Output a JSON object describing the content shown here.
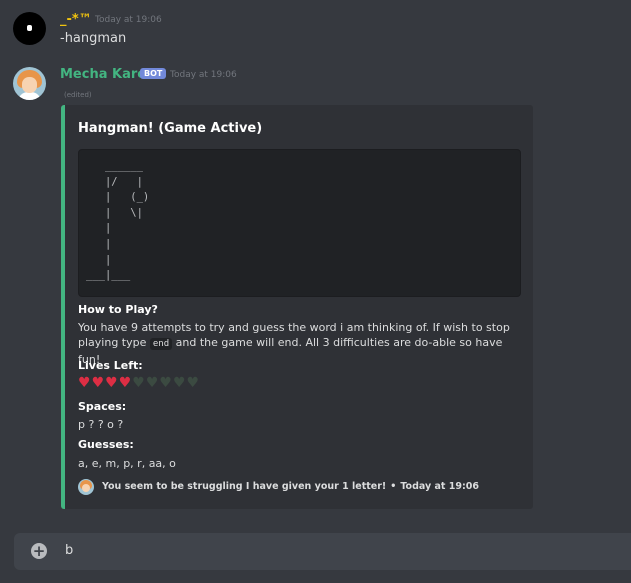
{
  "messages": [
    {
      "username": "_-*™",
      "timestamp": "Today at 19:06",
      "content": "-hangman"
    },
    {
      "username": "Mecha Karen",
      "badge": "BOT",
      "timestamp": "Today at 19:06",
      "edited": "(edited)",
      "embed": {
        "accent_color": "#43b581",
        "title": "Hangman! (Game Active)",
        "code": "   ______\n   |/   |\n   |   (_)\n   |   \\|\n   |\n   |\n   |\n___|___",
        "how_to_play_name": "How to Play?",
        "how_to_play_pre": "You have 9 attempts to try and guess the word i am thinking of. If wish to stop playing type",
        "how_to_play_code": "end",
        "how_to_play_post": "and the game will end. All 3 difficulties are do-able so have fun!",
        "lives_name": "Lives Left:",
        "lives_remaining": 4,
        "lives_total": 9,
        "spaces_name": "Spaces:",
        "spaces_value": "p ? ? o ?",
        "guesses_name": "Guesses:",
        "guesses_value": "a, e, m, p, r, aa, o",
        "footer_text": "You seem to be struggling I have given your 1 letter!",
        "footer_sep": "•",
        "footer_time": "Today at 19:06"
      }
    }
  ],
  "input": {
    "value": "b",
    "add_icon": "plus-circle-icon"
  },
  "colors": {
    "heart_full": "#dd2e44",
    "heart_empty": "#3b4a41"
  }
}
